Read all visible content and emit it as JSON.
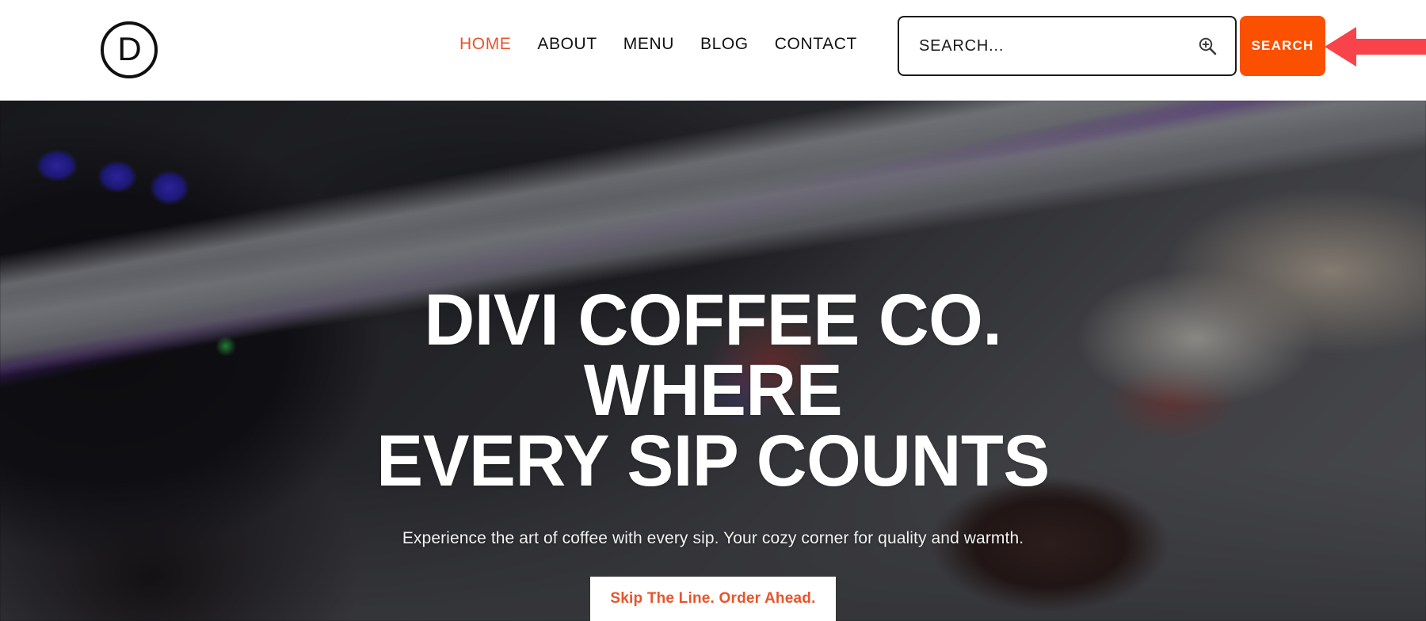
{
  "header": {
    "logo": {
      "letter": "D",
      "icon": "divi-logo-icon"
    },
    "nav": [
      {
        "label": "HOME",
        "active": true
      },
      {
        "label": "ABOUT",
        "active": false
      },
      {
        "label": "MENU",
        "active": false
      },
      {
        "label": "BLOG",
        "active": false
      },
      {
        "label": "CONTACT",
        "active": false
      }
    ],
    "search": {
      "placeholder": "SEARCH...",
      "value": "",
      "icon": "magnifier-zoom-in-icon",
      "button_label": "SEARCH",
      "button_color": "#fa5000"
    }
  },
  "annotation": {
    "arrow": "left-pointing-arrow",
    "color": "#f8434a",
    "points_to": "search-submit-button"
  },
  "hero": {
    "title_line1": "DIVI COFFEE CO. WHERE",
    "title_line2": "EVERY SIP COUNTS",
    "subtitle": "Experience the art of coffee with every sip. Your cozy corner for quality and warmth.",
    "cta_label": "Skip The Line. Order Ahead.",
    "cta_text_color": "#e8542a",
    "cta_bg_color": "#ffffff"
  },
  "colors": {
    "accent_orange": "#e8542a",
    "button_orange": "#fa5000",
    "annotation_red": "#f8434a",
    "text_dark": "#111111",
    "white": "#ffffff"
  }
}
